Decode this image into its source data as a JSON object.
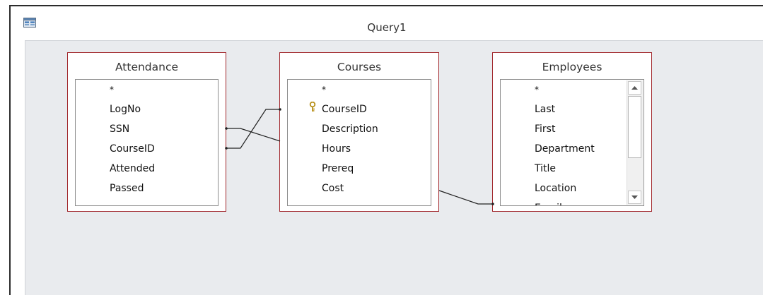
{
  "window": {
    "title": "Query1",
    "icon": "query-window-icon"
  },
  "tables": [
    {
      "name": "Attendance",
      "fields": [
        "*",
        "LogNo",
        "SSN",
        "CourseID",
        "Attended",
        "Passed"
      ],
      "primary_key": null
    },
    {
      "name": "Courses",
      "fields": [
        "*",
        "CourseID",
        "Description",
        "Hours",
        "Prereq",
        "Cost"
      ],
      "primary_key": "CourseID"
    },
    {
      "name": "Employees",
      "fields": [
        "*",
        "Last",
        "First",
        "Department",
        "Title",
        "Location"
      ],
      "primary_key": null,
      "has_scrollbar": true
    }
  ],
  "relationships": [
    {
      "from": "Attendance.CourseID",
      "to": "Courses.CourseID"
    },
    {
      "from": "Attendance.SSN",
      "to": "Employees.SSN"
    }
  ],
  "colors": {
    "table_border": "#a1262b",
    "canvas": "#e9ebee",
    "key_icon": "#c9a227"
  }
}
